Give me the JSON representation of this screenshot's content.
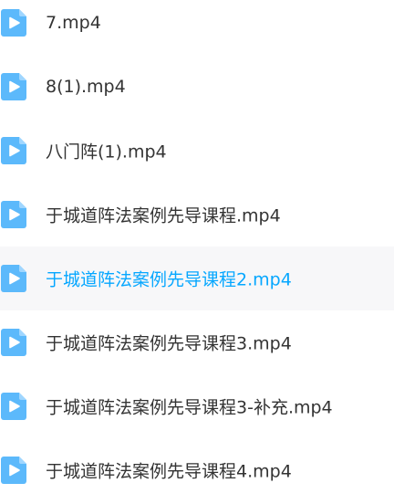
{
  "colors": {
    "icon_blue": "#5cb9fb",
    "icon_fold": "#9fd6ff",
    "text_default": "#333333",
    "text_selected": "#06a7ff",
    "selected_row_bg": "#f7f7f9"
  },
  "file_list": {
    "selected_index": 4,
    "items": [
      {
        "name": "7.mp4",
        "icon": "video-file-icon"
      },
      {
        "name": "8(1).mp4",
        "icon": "video-file-icon"
      },
      {
        "name": "八门阵(1).mp4",
        "icon": "video-file-icon"
      },
      {
        "name": "于城道阵法案例先导课程.mp4",
        "icon": "video-file-icon"
      },
      {
        "name": "于城道阵法案例先导课程2.mp4",
        "icon": "video-file-icon"
      },
      {
        "name": "于城道阵法案例先导课程3.mp4",
        "icon": "video-file-icon"
      },
      {
        "name": "于城道阵法案例先导课程3-补充.mp4",
        "icon": "video-file-icon"
      },
      {
        "name": "于城道阵法案例先导课程4.mp4",
        "icon": "video-file-icon"
      }
    ]
  }
}
